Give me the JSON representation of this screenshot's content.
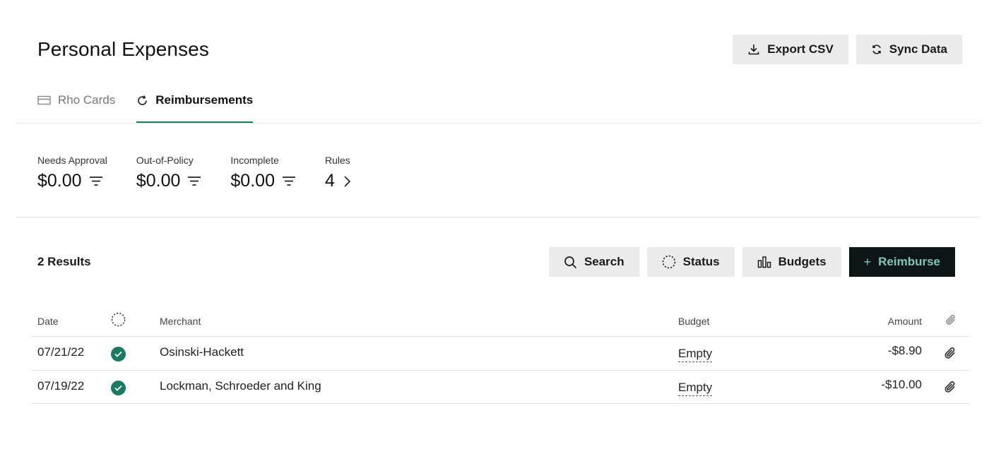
{
  "header": {
    "title": "Personal Expenses",
    "export_label": "Export CSV",
    "sync_label": "Sync Data"
  },
  "tabs": [
    {
      "label": "Rho Cards",
      "icon": "card-icon",
      "active": false
    },
    {
      "label": "Reimbursements",
      "icon": "refresh-icon",
      "active": true
    }
  ],
  "stats": [
    {
      "label": "Needs Approval",
      "value": "$0.00",
      "icon": "filter-icon"
    },
    {
      "label": "Out-of-Policy",
      "value": "$0.00",
      "icon": "filter-icon"
    },
    {
      "label": "Incomplete",
      "value": "$0.00",
      "icon": "filter-icon"
    },
    {
      "label": "Rules",
      "value": "4",
      "icon": "chevron-right-icon"
    }
  ],
  "results": {
    "count_label": "2 Results",
    "search_label": "Search",
    "status_label": "Status",
    "budgets_label": "Budgets",
    "reimburse_label": "Reimburse"
  },
  "table": {
    "columns": {
      "date": "Date",
      "merchant": "Merchant",
      "budget": "Budget",
      "amount": "Amount"
    },
    "rows": [
      {
        "date": "07/21/22",
        "status": "approved",
        "merchant": "Osinski-Hackett",
        "budget": "Empty",
        "amount": "-$8.90"
      },
      {
        "date": "07/19/22",
        "status": "approved",
        "merchant": "Lockman, Schroeder and King",
        "budget": "Empty",
        "amount": "-$10.00"
      }
    ]
  },
  "colors": {
    "accent": "#1a7a66",
    "primary_button_bg": "#0d1614",
    "primary_button_text": "#7fc7b4",
    "secondary_button_bg": "#ebebeb"
  }
}
